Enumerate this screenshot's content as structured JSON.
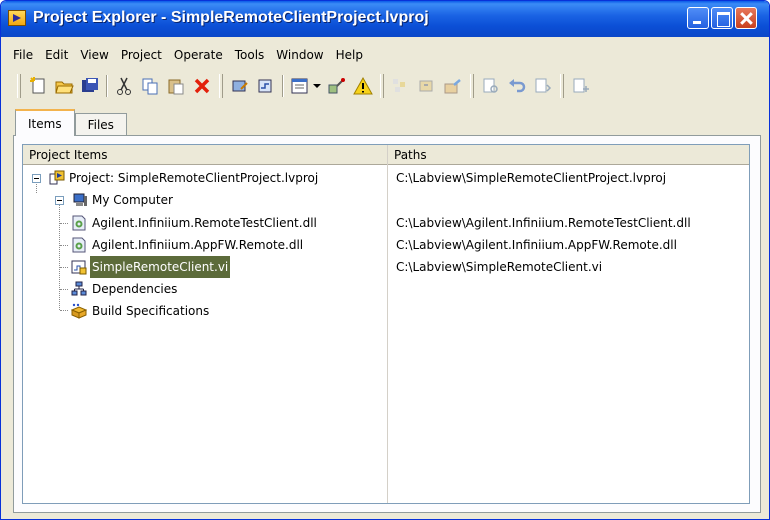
{
  "window": {
    "title": "Project Explorer - SimpleRemoteClientProject.lvproj",
    "accent": "#0a5ae8"
  },
  "menu": [
    "File",
    "Edit",
    "View",
    "Project",
    "Operate",
    "Tools",
    "Window",
    "Help"
  ],
  "toolbar": {
    "icons": [
      "new-icon",
      "open-icon",
      "save-all-icon",
      "cut-icon",
      "copy-icon",
      "paste-icon",
      "delete-icon",
      "project-properties-icon",
      "vi-icon",
      "view-dropdown-icon",
      "tools-icon",
      "warning-icon",
      "add-files-icon",
      "build-icon",
      "deploy-icon",
      "undo-icon",
      "redo-icon"
    ]
  },
  "tabs": [
    "Items",
    "Files"
  ],
  "columns": {
    "items": "Project Items",
    "paths": "Paths"
  },
  "tree": {
    "project": {
      "label": "Project: SimpleRemoteClientProject.lvproj",
      "path": "C:\\Labview\\SimpleRemoteClientProject.lvproj"
    },
    "computer": {
      "label": "My Computer"
    },
    "children": [
      {
        "label": "Agilent.Infiniium.RemoteTestClient.dll",
        "path": "C:\\Labview\\Agilent.Infiniium.RemoteTestClient.dll"
      },
      {
        "label": "Agilent.Infiniium.AppFW.Remote.dll",
        "path": "C:\\Labview\\Agilent.Infiniium.AppFW.Remote.dll"
      },
      {
        "label": "SimpleRemoteClient.vi",
        "path": "C:\\Labview\\SimpleRemoteClient.vi",
        "selected": true
      },
      {
        "label": "Dependencies",
        "path": ""
      },
      {
        "label": "Build Specifications",
        "path": ""
      }
    ]
  }
}
